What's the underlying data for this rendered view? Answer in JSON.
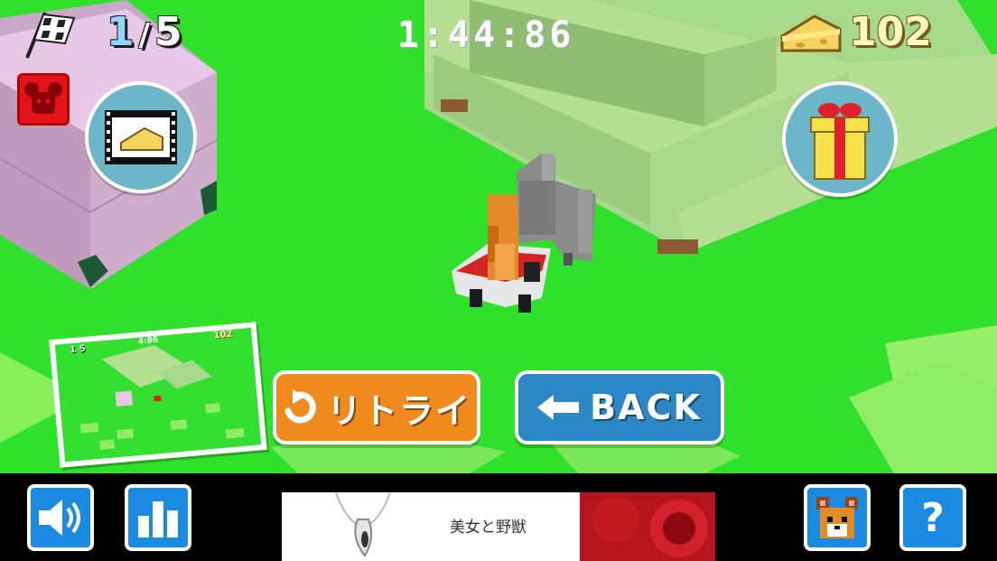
{
  "hud": {
    "lap_current": "1",
    "lap_separator": "/",
    "lap_total": "5",
    "timer": "1:44:86",
    "cheese_count": "102"
  },
  "minimap": {
    "lap": "1 5",
    "time": "4:86",
    "cheese": "102"
  },
  "buttons": {
    "retry_label": "リトライ",
    "back_label": "BACK",
    "help_label": "?"
  },
  "ad": {
    "text": "美女と野獣"
  },
  "icons": {
    "flag": "checkered-flag-icon",
    "cheese": "cheese-icon",
    "mouse": "mouse-face-icon",
    "video": "video-cheese-icon",
    "gift": "gift-icon",
    "sound": "speaker-icon",
    "ranking": "bar-chart-icon",
    "character": "character-face-icon"
  },
  "colors": {
    "grass": "#2fe12b",
    "retry": "#f08a1d",
    "back": "#2c87c6",
    "square_button": "#1a8be0"
  }
}
